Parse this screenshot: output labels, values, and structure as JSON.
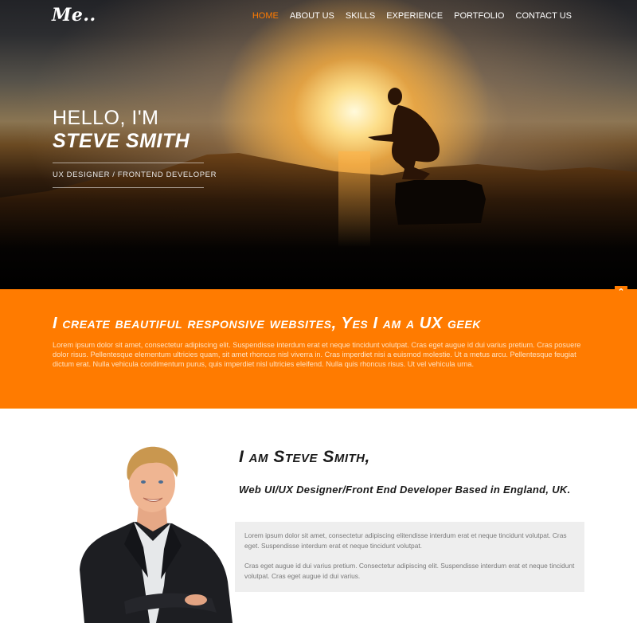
{
  "header": {
    "logo": "Me..",
    "nav": [
      {
        "label": "HOME",
        "active": true
      },
      {
        "label": "ABOUT US",
        "active": false
      },
      {
        "label": "SKILLS",
        "active": false
      },
      {
        "label": "EXPERIENCE",
        "active": false
      },
      {
        "label": "PORTFOLIO",
        "active": false
      },
      {
        "label": "CONTACT US",
        "active": false
      }
    ]
  },
  "hero": {
    "greeting": "HELLO, I'M",
    "name": "STEVE SMITH",
    "role": "UX DESIGNER / FRONTEND DEVELOPER",
    "image": "sunset-silhouette-photo"
  },
  "band": {
    "scroll_top_icon": "chevron-up-icon",
    "heading": "I create beautiful responsive websites, Yes I am a UX geek",
    "body": "Lorem ipsum dolor sit amet, consectetur adipiscing elit. Suspendisse interdum erat et neque tincidunt volutpat. Cras eget augue id dui varius pretium. Cras posuere dolor risus. Pellentesque elementum ultricies quam, sit amet rhoncus nisl viverra in. Cras imperdiet nisi a euismod molestie. Ut a metus arcu. Pellentesque feugiat dictum erat. Nulla vehicula condimentum purus, quis imperdiet nisl ultricies eleifend. Nulla quis rhoncus risus. Ut vel vehicula urna."
  },
  "about": {
    "title": "I am Steve Smith,",
    "subtitle": "Web UI/UX Designer/Front End Developer Based in England, UK.",
    "paragraphs": [
      "Lorem ipsum dolor sit amet, consectetur adipiscing elitendisse interdum erat et neque tincidunt volutpat. Cras eget. Suspendisse interdum erat et neque tincidunt volutpat.",
      "Cras eget augue id dui varius pretium. Consectetur adipiscing elit. Suspendisse interdum erat et neque tincidunt volutpat. Cras eget augue id dui varius."
    ],
    "image": "portrait-photo"
  },
  "colors": {
    "accent": "#ff7b00",
    "band_text": "#ffe2c2",
    "box_bg": "#eeeeee",
    "box_text": "#7a7a7a",
    "heading_dark": "#1a1a1a"
  }
}
